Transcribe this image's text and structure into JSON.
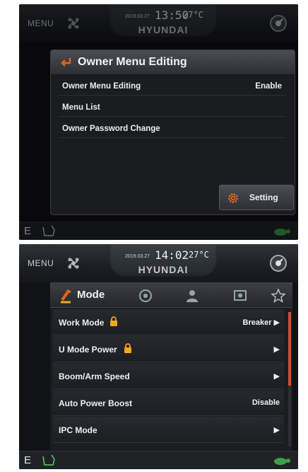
{
  "screen1": {
    "topbar": {
      "menu_label": "MENU",
      "date": "2019.03.27",
      "time": "13:50",
      "temperature": "27°C",
      "brand": "HYUNDAI"
    },
    "dialog": {
      "title": "Owner Menu Editing",
      "rows": [
        {
          "label": "Owner Menu Editing",
          "value": "Enable"
        },
        {
          "label": "Menu List",
          "value": ""
        },
        {
          "label": "Owner Password Change",
          "value": ""
        }
      ],
      "setting_button": "Setting"
    },
    "bottombar": {
      "mode_letter": "E"
    }
  },
  "screen2": {
    "topbar": {
      "menu_label": "MENU",
      "date": "2019.03.27",
      "time": "14:02",
      "temperature": "27°C",
      "brand": "HYUNDAI"
    },
    "panel": {
      "active_tab": "Mode",
      "tabs": [
        "mode-tab",
        "monitoring-tab",
        "user-tab",
        "display-tab",
        "favorites-tab"
      ],
      "rows": [
        {
          "label": "Work Mode",
          "locked": true,
          "value": "Breaker ▶"
        },
        {
          "label": "U Mode Power",
          "locked": true,
          "value": "▶"
        },
        {
          "label": "Boom/Arm Speed",
          "locked": false,
          "value": "▶"
        },
        {
          "label": "Auto Power Boost",
          "locked": false,
          "value": "Disable"
        },
        {
          "label": "IPC Mode",
          "locked": false,
          "value": "▶"
        }
      ]
    },
    "bottombar": {
      "mode_letter": "E"
    }
  },
  "colors": {
    "accent_orange": "#e8641f",
    "lock_yellow": "#f0a81c",
    "turtle_green": "#3fa04a",
    "scroll_accent": "#d4502a"
  }
}
